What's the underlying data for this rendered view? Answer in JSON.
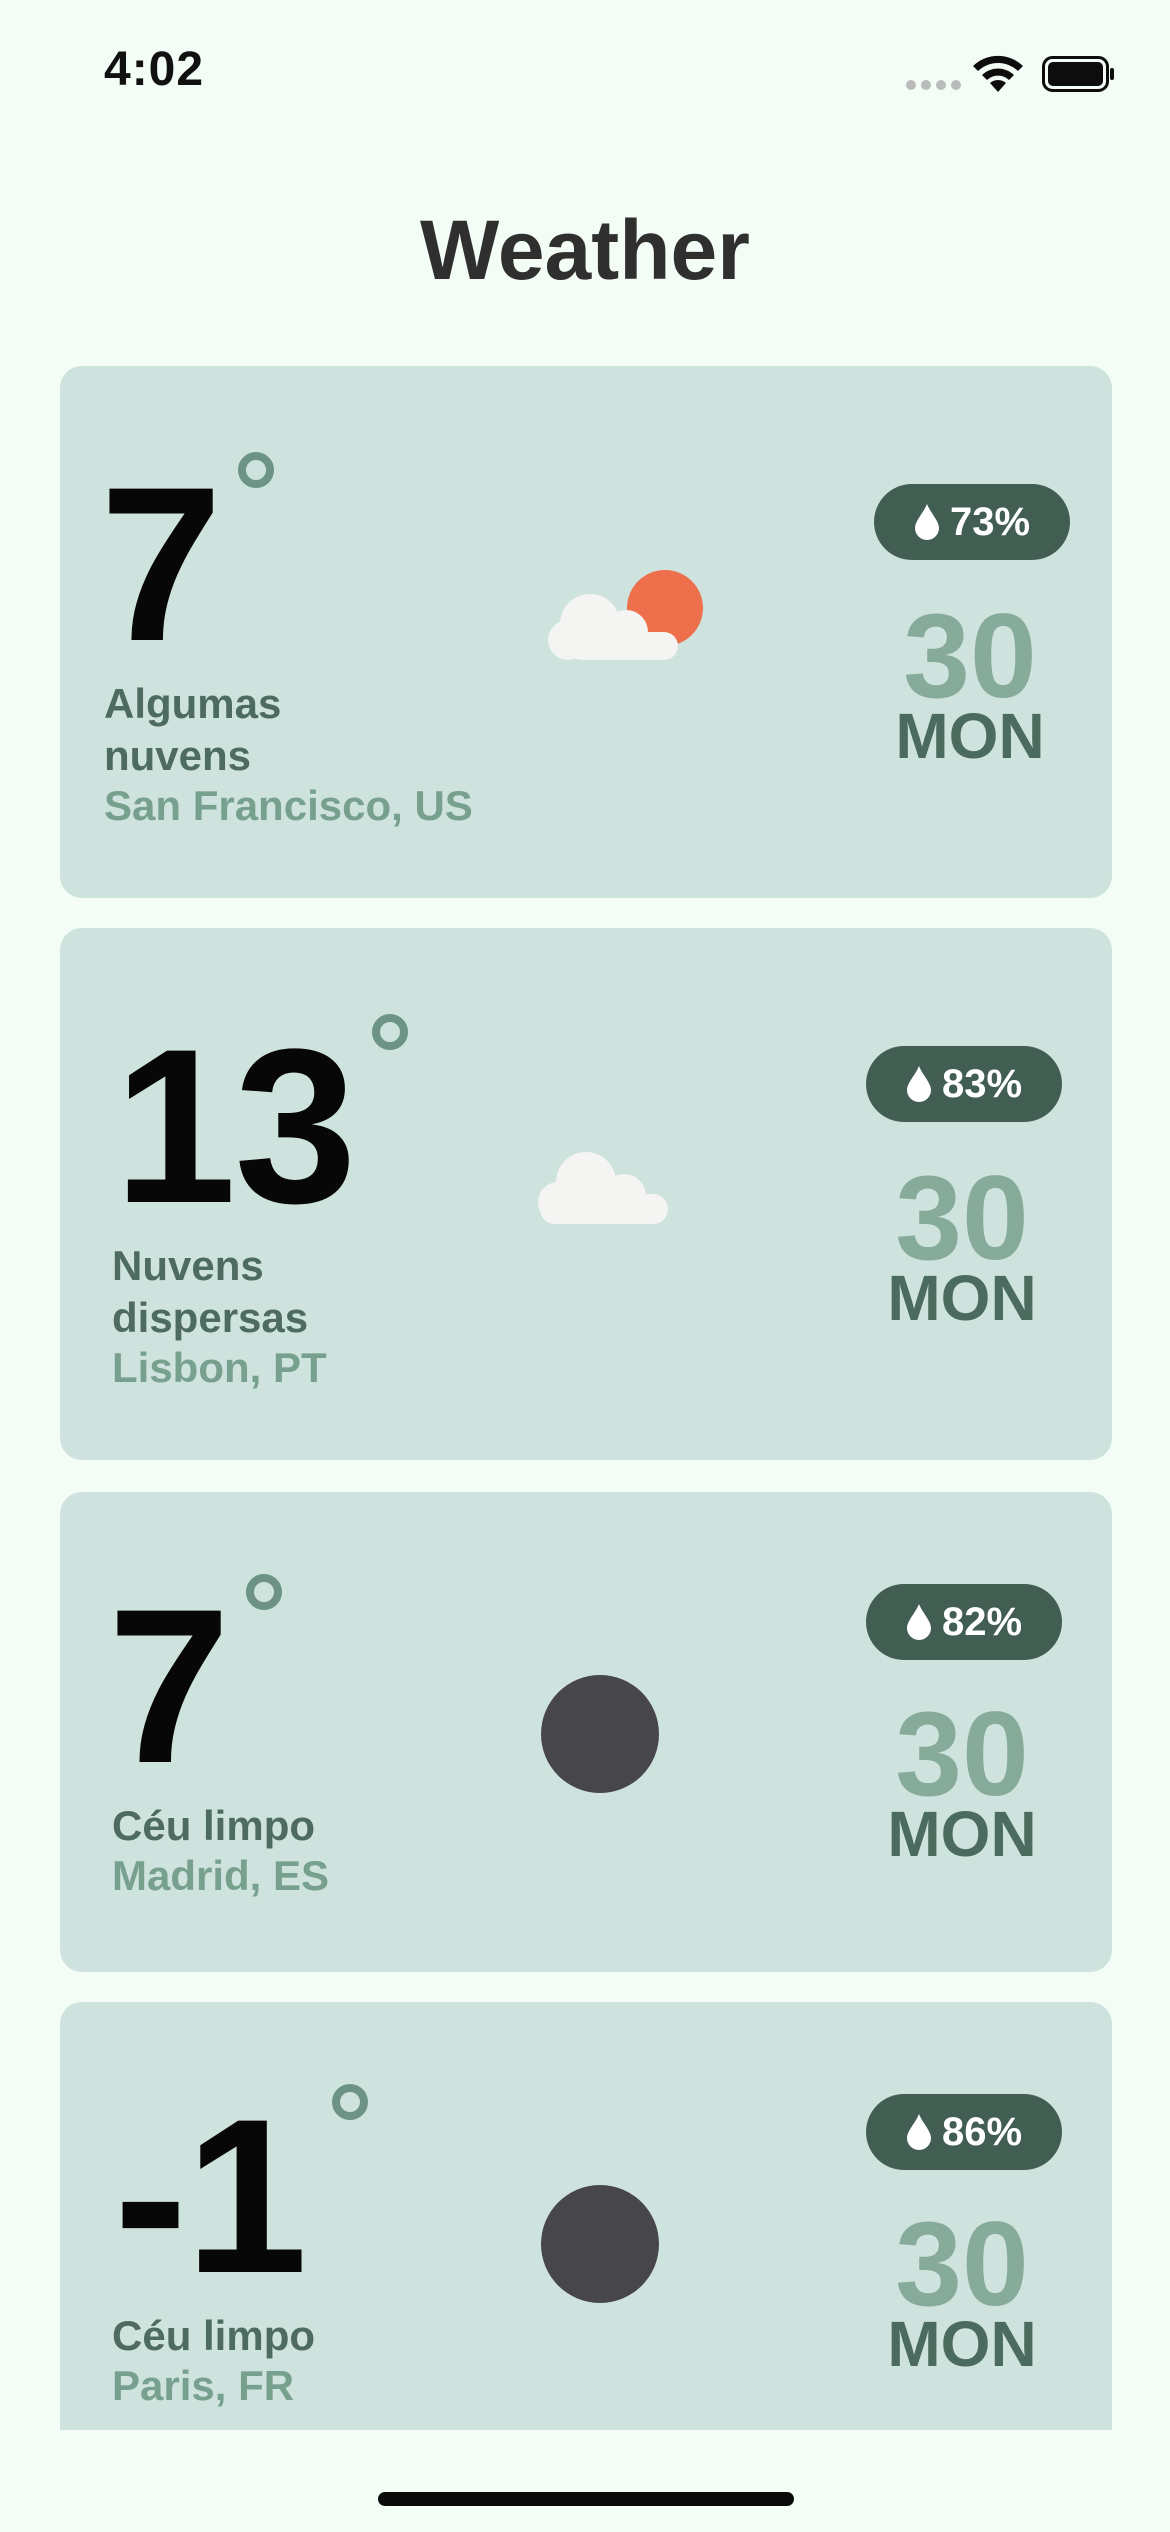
{
  "status_bar": {
    "time": "4:02"
  },
  "header": {
    "title": "Weather"
  },
  "cards": [
    {
      "temp": "7",
      "description": "Algumas nuvens",
      "city": "San Francisco, US",
      "humidity": "73%",
      "day_number": "30",
      "day_name": "MON",
      "icon": "partly-cloudy-day-icon"
    },
    {
      "temp": "13",
      "description": "Nuvens dispersas",
      "city": "Lisbon, PT",
      "humidity": "83%",
      "day_number": "30",
      "day_name": "MON",
      "icon": "cloud-icon"
    },
    {
      "temp": "7",
      "description": "Céu limpo",
      "city": "Madrid, ES",
      "humidity": "82%",
      "day_number": "30",
      "day_name": "MON",
      "icon": "clear-night-icon"
    },
    {
      "temp": "-1",
      "description": "Céu limpo",
      "city": "Paris, FR",
      "humidity": "86%",
      "day_number": "30",
      "day_name": "MON",
      "icon": "clear-night-icon"
    }
  ],
  "colors": {
    "background": "#f3fdf6",
    "card": "#cfe3de",
    "badge": "#425d52",
    "accent_day_number": "#87ab9b",
    "sun": "#ee6f4b",
    "moon": "#474649"
  }
}
